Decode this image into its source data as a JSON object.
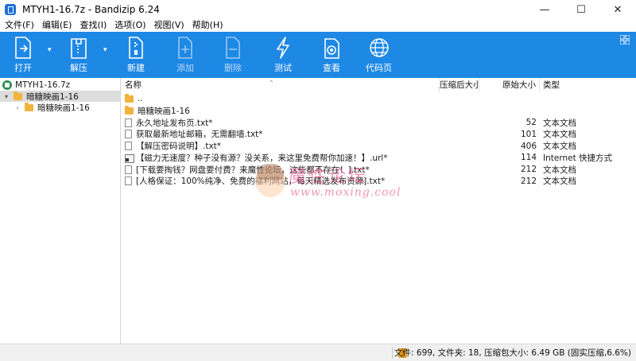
{
  "window": {
    "title": "MTYH1-16.7z - Bandizip 6.24",
    "app_icon": "bandizip-icon",
    "controls": {
      "minimize": "—",
      "maximize": "☐",
      "close": "✕"
    }
  },
  "menu": [
    "文件(F)",
    "编辑(E)",
    "查找(I)",
    "选项(O)",
    "视图(V)",
    "帮助(H)"
  ],
  "toolbar": {
    "background": "#1e88e5",
    "buttons": [
      {
        "label": "打开",
        "icon": "open-icon",
        "dropdown": true,
        "enabled": true
      },
      {
        "label": "解压",
        "icon": "extract-icon",
        "dropdown": true,
        "enabled": true
      },
      {
        "label": "新建",
        "icon": "new-archive-icon",
        "dropdown": false,
        "enabled": true
      },
      {
        "label": "添加",
        "icon": "add-file-icon",
        "dropdown": false,
        "enabled": false
      },
      {
        "label": "删除",
        "icon": "delete-file-icon",
        "dropdown": false,
        "enabled": false
      },
      {
        "label": "测试",
        "icon": "test-lightning-icon",
        "dropdown": false,
        "enabled": true
      },
      {
        "label": "查看",
        "icon": "view-eye-icon",
        "dropdown": false,
        "enabled": true
      },
      {
        "label": "代码页",
        "icon": "codepage-globe-icon",
        "dropdown": false,
        "enabled": true
      }
    ],
    "layout_icon": "grid-layout-icon"
  },
  "tree": {
    "root": "MTYH1-16.7z",
    "items": [
      {
        "label": "暗糖映画1-16",
        "expanded": true,
        "selected": true
      },
      {
        "label": "暗糖映画1-16",
        "expanded": false,
        "selected": false
      }
    ]
  },
  "list": {
    "columns": {
      "name": "名称",
      "packed": "压缩后大小",
      "original": "原始大小",
      "type": "类型"
    },
    "rows": [
      {
        "name": "..",
        "packed": "",
        "original": "",
        "type": "",
        "icon": "folder"
      },
      {
        "name": "暗糖映画1-16",
        "packed": "",
        "original": "",
        "type": "",
        "icon": "folder"
      },
      {
        "name": "永久地址发布页.txt*",
        "packed": "",
        "original": "52",
        "type": "文本文档",
        "icon": "file"
      },
      {
        "name": "获取最新地址邮箱，无需翻墙.txt*",
        "packed": "",
        "original": "101",
        "type": "文本文档",
        "icon": "file"
      },
      {
        "name": "【解压密码说明】.txt*",
        "packed": "",
        "original": "406",
        "type": "文本文档",
        "icon": "file"
      },
      {
        "name": "【磁力无速度？种子没有源？没关系，来这里免费帮你加速！】.url*",
        "packed": "",
        "original": "114",
        "type": "Internet 快捷方式",
        "icon": "url"
      },
      {
        "name": "[下载要掏钱？网盘要付费？来魔性论坛，这些都不存在！].txt*",
        "packed": "",
        "original": "212",
        "type": "文本文档",
        "icon": "file"
      },
      {
        "name": "[人格保证：100%纯净、免费的福利网站，每天精选发布资源].txt*",
        "packed": "",
        "original": "212",
        "type": "文本文档",
        "icon": "file"
      }
    ]
  },
  "watermark": {
    "text": "魔性论坛",
    "url": "www.moxing.cool"
  },
  "status": {
    "text": "文件: 699, 文件夹: 18, 压缩包大小: 6.49 GB (固实压缩,6.6%)"
  }
}
